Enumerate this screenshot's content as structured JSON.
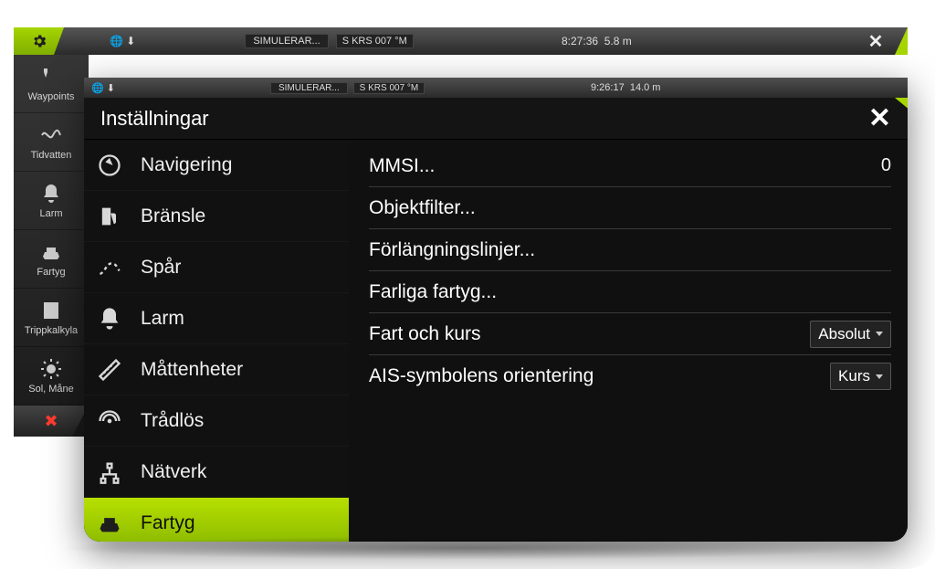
{
  "rear": {
    "sim_label": "SIMULERAR...",
    "krs": "S KRS 007 °M",
    "time": "8:27:36",
    "depth": "5.8 m",
    "close_glyph": "✕",
    "rail": [
      {
        "id": "waypoints",
        "label": "Waypoints"
      },
      {
        "id": "tidvatten",
        "label": "Tidvatten"
      },
      {
        "id": "larm",
        "label": "Larm"
      },
      {
        "id": "fartyg",
        "label": "Fartyg"
      },
      {
        "id": "trippkalkyl",
        "label": "Trippkalkyla"
      },
      {
        "id": "sol",
        "label": "Sol, Måne"
      }
    ]
  },
  "front": {
    "sim_label": "SIMULERAR...",
    "krs": "S KRS 007 °M",
    "time": "9:26:17",
    "depth": "14.0 m",
    "title": "Inställningar",
    "close_glyph": "✕",
    "categories": [
      {
        "id": "navigering",
        "label": "Navigering"
      },
      {
        "id": "bransle",
        "label": "Bränsle"
      },
      {
        "id": "spar",
        "label": "Spår"
      },
      {
        "id": "larm",
        "label": "Larm"
      },
      {
        "id": "mattenheter",
        "label": "Måttenheter"
      },
      {
        "id": "tradlos",
        "label": "Trådlös"
      },
      {
        "id": "natverk",
        "label": "Nätverk"
      },
      {
        "id": "fartyg",
        "label": "Fartyg"
      }
    ],
    "details": {
      "mmsi_label": "MMSI...",
      "mmsi_value": "0",
      "objektfilter_label": "Objektfilter...",
      "forlangning_label": "Förlängningslinjer...",
      "farliga_label": "Farliga fartyg...",
      "fartkurs_label": "Fart och kurs",
      "fartkurs_value": "Absolut",
      "ais_label": "AIS-symbolens orientering",
      "ais_value": "Kurs"
    }
  }
}
